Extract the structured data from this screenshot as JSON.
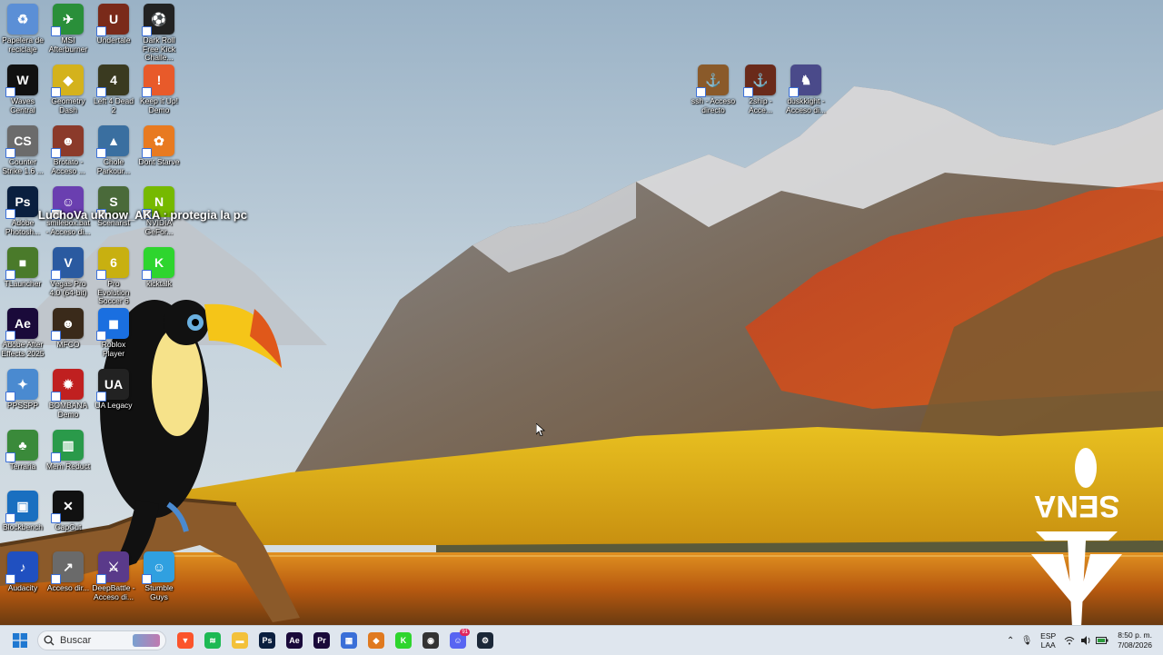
{
  "desktop": {
    "icons": [
      {
        "label": "Papelera de reciclaje",
        "icon": "recycle-bin-icon",
        "color": "#5b8fd6",
        "glyph": "♻"
      },
      {
        "label": "MSI Afterburner",
        "icon": "msi-afterburner-icon",
        "color": "#2a8f3a",
        "glyph": "✈"
      },
      {
        "label": "Undertale",
        "icon": "undertale-icon",
        "color": "#7a2a1a",
        "glyph": "U"
      },
      {
        "label": "Dark Roll Free Kick Challe...",
        "icon": "soccer-ball-icon",
        "color": "#222222",
        "glyph": "⚽"
      },
      {
        "label": "Waves Central",
        "icon": "waves-icon",
        "color": "#111111",
        "glyph": "W"
      },
      {
        "label": "Geometry Dash",
        "icon": "geometry-dash-icon",
        "color": "#d4b21c",
        "glyph": "◆"
      },
      {
        "label": "Left 4 Dead 2",
        "icon": "left4dead-icon",
        "color": "#3a3a20",
        "glyph": "4"
      },
      {
        "label": "Keep it Up! Demo",
        "icon": "keep-it-up-icon",
        "color": "#e85a2a",
        "glyph": "!"
      },
      {
        "label": "Counter Strike 1.6 ...",
        "icon": "counter-strike-icon",
        "color": "#6b6b6b",
        "glyph": "CS"
      },
      {
        "label": "Brotato - Acceso ...",
        "icon": "brotato-icon",
        "color": "#8b3a2a",
        "glyph": "☻"
      },
      {
        "label": "Chole Parkour...",
        "icon": "parkour-icon",
        "color": "#3a6fa0",
        "glyph": "▲"
      },
      {
        "label": "Dont Starve",
        "icon": "dont-starve-icon",
        "color": "#e87a20",
        "glyph": "✿"
      },
      {
        "label": "Adobe Photosh...",
        "icon": "photoshop-icon",
        "color": "#0a1f3f",
        "glyph": "Ps"
      },
      {
        "label": "smilebox.bat - Acceso di...",
        "icon": "smilebox-icon",
        "color": "#6a3fb0",
        "glyph": "☺"
      },
      {
        "label": "Scenarist",
        "icon": "scenarist-icon",
        "color": "#4a6a3a",
        "glyph": "S"
      },
      {
        "label": "NVIDIA GeFor...",
        "icon": "nvidia-icon",
        "color": "#76b900",
        "glyph": "N"
      },
      {
        "label": "TLauncher",
        "icon": "tlauncher-icon",
        "color": "#4a7a2a",
        "glyph": "■"
      },
      {
        "label": "Vegas Pro 4.0 (64-bit)",
        "icon": "vegas-icon",
        "color": "#2a5aa0",
        "glyph": "V"
      },
      {
        "label": "Pro Evolution Soccer 6",
        "icon": "pes6-icon",
        "color": "#c8b010",
        "glyph": "6"
      },
      {
        "label": "kicktalk",
        "icon": "kicktalk-icon",
        "color": "#2ed52e",
        "glyph": "K"
      },
      {
        "label": "Adobe After Effects 2025",
        "icon": "after-effects-icon",
        "color": "#1a0a3a",
        "glyph": "Ae"
      },
      {
        "label": "MFCO",
        "icon": "mfco-icon",
        "color": "#3a2a1a",
        "glyph": "☻"
      },
      {
        "label": "Roblox Player",
        "icon": "roblox-icon",
        "color": "#1a6fe0",
        "glyph": "◼"
      },
      {
        "label": "PPSSPP",
        "icon": "ppsspp-icon",
        "color": "#4a8ad0",
        "glyph": "✦"
      },
      {
        "label": "BOMBANA Demo",
        "icon": "bombana-icon",
        "color": "#c02020",
        "glyph": "✹"
      },
      {
        "label": "UA Legacy",
        "icon": "ua-icon",
        "color": "#222222",
        "glyph": "UA"
      },
      {
        "label": "Terraria",
        "icon": "terraria-icon",
        "color": "#3a8a3a",
        "glyph": "♣"
      },
      {
        "label": "Mem Reduct",
        "icon": "mem-reduct-icon",
        "color": "#2a9a4a",
        "glyph": "▥"
      },
      {
        "label": "Blockbench",
        "icon": "blockbench-icon",
        "color": "#1a6fc0",
        "glyph": "▣"
      },
      {
        "label": "CapCut",
        "icon": "capcut-icon",
        "color": "#111111",
        "glyph": "✕"
      },
      {
        "label": "Audacity",
        "icon": "audacity-icon",
        "color": "#2050c0",
        "glyph": "♪"
      },
      {
        "label": "Acceso dir...",
        "icon": "shortcut-icon",
        "color": "#6a6a6a",
        "glyph": "↗"
      },
      {
        "label": "DeepBattle - Acceso di...",
        "icon": "deepbattle-icon",
        "color": "#5a3a8a",
        "glyph": "⚔"
      },
      {
        "label": "Stumble Guys",
        "icon": "stumble-guys-icon",
        "color": "#30a0e0",
        "glyph": "☺"
      },
      {
        "label": "ssh - Acceso directo",
        "icon": "ship-icon",
        "color": "#8a5a2a",
        "glyph": "⚓"
      },
      {
        "label": "2ship - Acce...",
        "icon": "ship2-icon",
        "color": "#6a2a1a",
        "glyph": "⚓"
      },
      {
        "label": "duskkight - Acceso di...",
        "icon": "duskknight-icon",
        "color": "#4a4a8a",
        "glyph": "♞"
      }
    ],
    "popup_text": "LuchoVa uknow_AKA : protegia la pc",
    "sena_text": "SENA"
  },
  "taskbar": {
    "search_placeholder": "Buscar",
    "apps": [
      {
        "name": "brave-icon",
        "color": "#fb542b",
        "glyph": "▼"
      },
      {
        "name": "spotify-icon",
        "color": "#1db954",
        "glyph": "≋"
      },
      {
        "name": "file-explorer-icon",
        "color": "#f3c13a",
        "glyph": "▬"
      },
      {
        "name": "photoshop-icon",
        "color": "#0a1f3f",
        "glyph": "Ps"
      },
      {
        "name": "after-effects-icon",
        "color": "#1a0a3a",
        "glyph": "Ae"
      },
      {
        "name": "premiere-icon",
        "color": "#1a0a3a",
        "glyph": "Pr"
      },
      {
        "name": "microsoft-store-icon",
        "color": "#3a6fd8",
        "glyph": "▦"
      },
      {
        "name": "vpn-shield-icon",
        "color": "#e07a20",
        "glyph": "◆"
      },
      {
        "name": "kick-icon",
        "color": "#2ed52e",
        "glyph": "K"
      },
      {
        "name": "obs-icon",
        "color": "#333333",
        "glyph": "◉"
      },
      {
        "name": "discord-icon",
        "color": "#5865f2",
        "glyph": "☺",
        "badge": "91"
      },
      {
        "name": "steam-icon",
        "color": "#1b2838",
        "glyph": "⚙"
      }
    ],
    "tray": {
      "language_line1": "ESP",
      "language_line2": "LAA",
      "time": "8:50 p. m.",
      "date": "7/08/2026"
    }
  }
}
